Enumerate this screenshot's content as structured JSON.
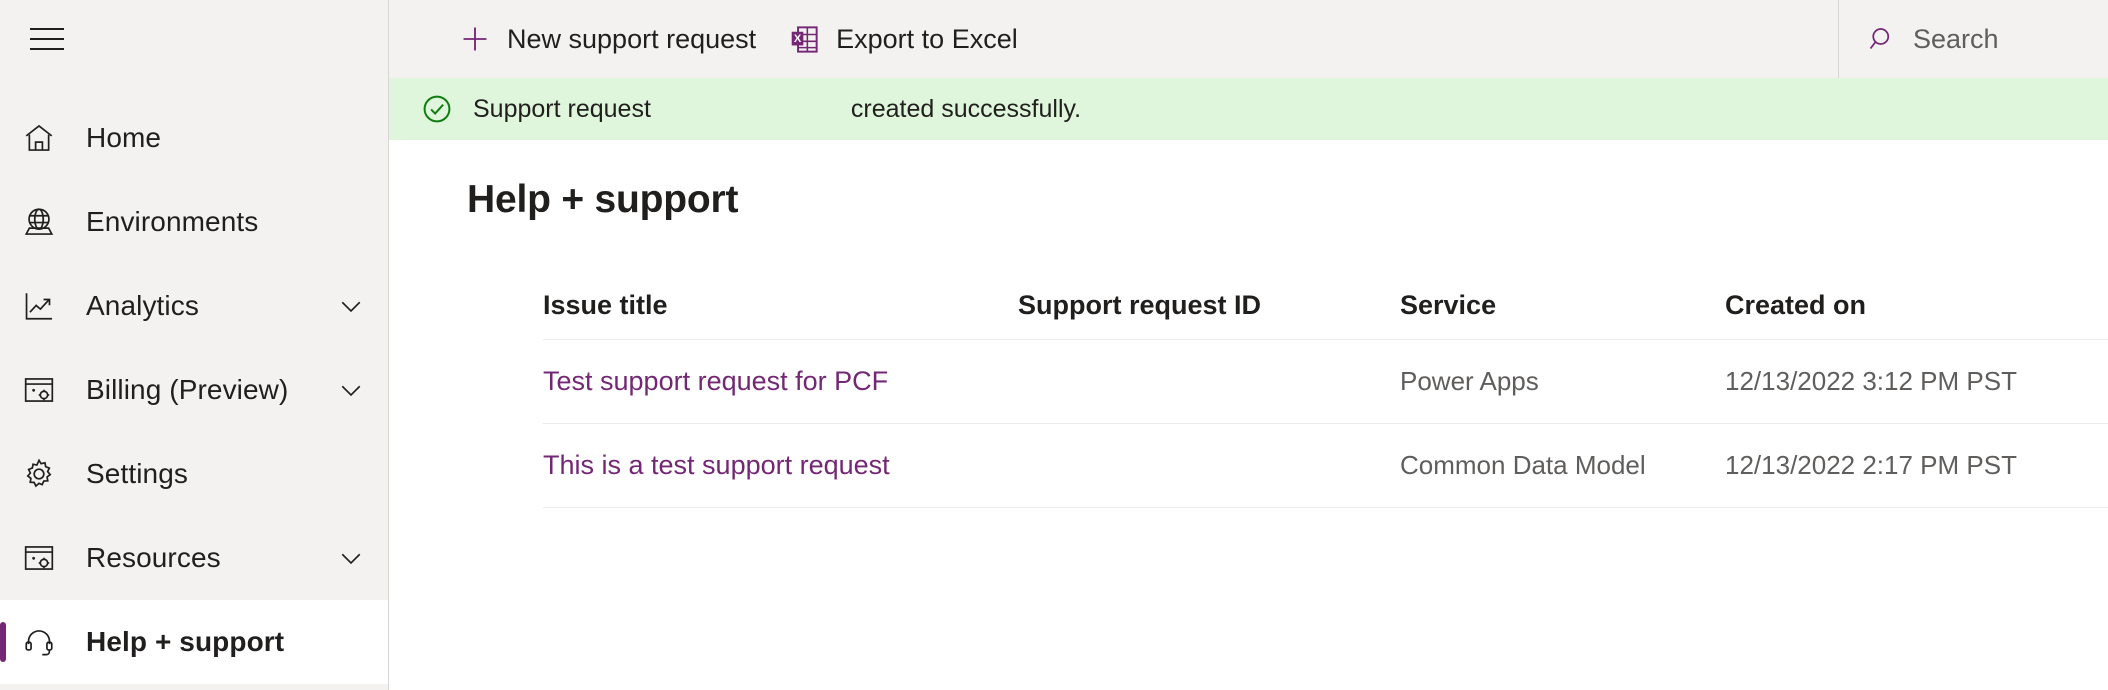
{
  "sidebar": {
    "menu_icon": "hamburger-icon",
    "items": [
      {
        "label": "Home",
        "icon": "home-icon",
        "chevron": false,
        "active": false
      },
      {
        "label": "Environments",
        "icon": "globe-icon",
        "chevron": false,
        "active": false
      },
      {
        "label": "Analytics",
        "icon": "chart-line-icon",
        "chevron": true,
        "active": false
      },
      {
        "label": "Billing (Preview)",
        "icon": "billing-icon",
        "chevron": true,
        "active": false
      },
      {
        "label": "Settings",
        "icon": "gear-icon",
        "chevron": false,
        "active": false
      },
      {
        "label": "Resources",
        "icon": "resources-icon",
        "chevron": true,
        "active": false
      },
      {
        "label": "Help + support",
        "icon": "headset-icon",
        "chevron": false,
        "active": true
      }
    ]
  },
  "command_bar": {
    "new_request_label": "New support request",
    "new_request_icon": "plus-icon",
    "export_label": "Export to Excel",
    "export_icon": "excel-icon"
  },
  "search": {
    "placeholder": "Search",
    "value": "",
    "icon": "search-icon"
  },
  "banner": {
    "icon": "check-circle-icon",
    "message_prefix": "Support request",
    "request_id": "",
    "message_suffix": "created successfully."
  },
  "page": {
    "title": "Help + support"
  },
  "table": {
    "columns": [
      "Issue title",
      "Support request ID",
      "Service",
      "Created on"
    ],
    "rows": [
      {
        "issue_title": "Test support request for PCF",
        "support_request_id": "",
        "service": "Power Apps",
        "created_on": "12/13/2022 3:12 PM PST"
      },
      {
        "issue_title": "This is a test support request",
        "support_request_id": "",
        "service": "Common Data Model",
        "created_on": "12/13/2022 2:17 PM PST"
      }
    ]
  },
  "colors": {
    "accent_purple": "#742774",
    "sidebar_bg": "#f3f2f1",
    "banner_bg": "#dff6dd",
    "banner_icon_green": "#107c10",
    "text_primary": "#201f1e",
    "text_secondary": "#605e5c"
  }
}
